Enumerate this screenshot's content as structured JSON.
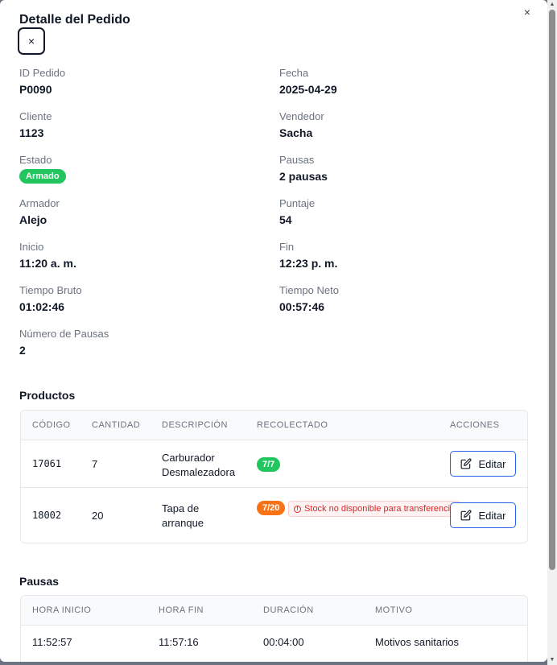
{
  "modal": {
    "title": "Detalle del Pedido",
    "close_icon": "×"
  },
  "details": {
    "id_label": "ID Pedido",
    "id_value": "P0090",
    "fecha_label": "Fecha",
    "fecha_value": "2025-04-29",
    "cliente_label": "Cliente",
    "cliente_value": "1123",
    "vendedor_label": "Vendedor",
    "vendedor_value": "Sacha",
    "estado_label": "Estado",
    "estado_value": "Armado",
    "pausas_label": "Pausas",
    "pausas_value": "2 pausas",
    "armador_label": "Armador",
    "armador_value": "Alejo",
    "puntaje_label": "Puntaje",
    "puntaje_value": "54",
    "inicio_label": "Inicio",
    "inicio_value": "11:20 a. m.",
    "fin_label": "Fin",
    "fin_value": "12:23 p. m.",
    "bruto_label": "Tiempo Bruto",
    "bruto_value": "01:02:46",
    "neto_label": "Tiempo Neto",
    "neto_value": "00:57:46",
    "num_pausas_label": "Número de Pausas",
    "num_pausas_value": "2"
  },
  "productos": {
    "title": "Productos",
    "headers": {
      "codigo": "CÓDIGO",
      "cantidad": "CANTIDAD",
      "descripcion": "DESCRIPCIÓN",
      "recolectado": "RECOLECTADO",
      "acciones": "ACCIONES"
    },
    "rows": [
      {
        "codigo": "17061",
        "cantidad": "7",
        "desc1": "Carburador",
        "desc2": "Desmalezadora",
        "recolectado": "7/7",
        "status": "complete",
        "warning": "",
        "action": "Editar"
      },
      {
        "codigo": "18002",
        "cantidad": "20",
        "desc1": "Tapa de",
        "desc2": "arranque",
        "recolectado": "7/20",
        "status": "partial",
        "warning": "Stock no disponible para transferencia",
        "action": "Editar"
      }
    ]
  },
  "pausas": {
    "title": "Pausas",
    "headers": {
      "hora_inicio": "HORA INICIO",
      "hora_fin": "HORA FIN",
      "duracion": "DURACIÓN",
      "motivo": "MOTIVO"
    },
    "rows": [
      {
        "hora_inicio": "11:52:57",
        "hora_fin": "11:57:16",
        "duracion": "00:04:00",
        "motivo": "Motivos sanitarios"
      }
    ]
  },
  "colors": {
    "success": "#22c55e",
    "warning": "#f97316",
    "danger": "#dc2626",
    "accent": "#2563eb"
  },
  "icons": {
    "close": "close-icon",
    "edit": "edit-icon",
    "alert": "alert-circle-icon"
  }
}
